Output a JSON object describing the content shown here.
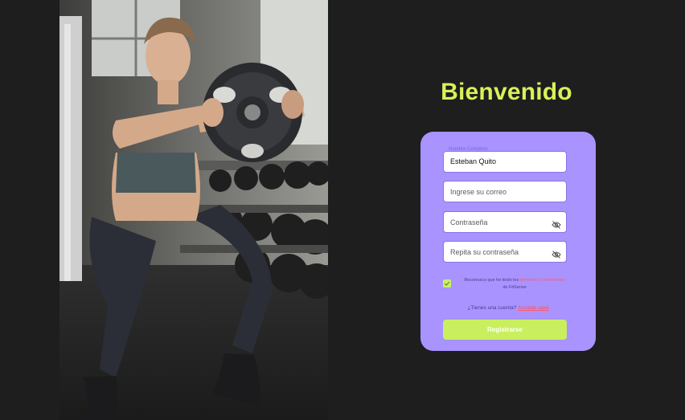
{
  "title": "Bienvenido",
  "form": {
    "name_label": "Nombre Completo",
    "name_value": "Esteban Quito",
    "email_placeholder": "Ingrese su correo",
    "password_placeholder": "Contraseña",
    "repeat_password_placeholder": "Repita su contraseña",
    "terms_text_1": "Reconozco que he leído los ",
    "terms_link": "términos y condiciones",
    "terms_text_2": " de FitSense",
    "terms_checked": true,
    "account_question": "¿Tienes una cuenta? ",
    "login_link": "Accede aquí",
    "register_label": "Registrarse"
  },
  "icons": {
    "password_toggle": "eye-off-icon",
    "repeat_password_toggle": "eye-off-icon",
    "checkbox": "check-icon"
  },
  "colors": {
    "background": "#1e1e1e",
    "title": "#d8f15a",
    "card": "#a993ff",
    "button": "#c9ef5e",
    "link": "#ff5a6b"
  }
}
